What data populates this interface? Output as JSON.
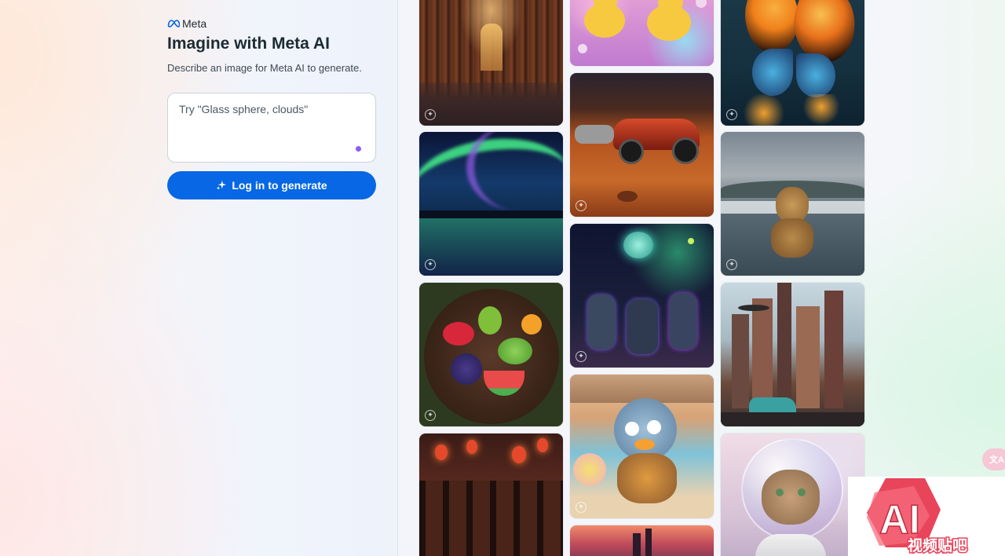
{
  "brand": {
    "name": "Meta",
    "logo_icon": "meta-infinity-icon",
    "logo_color": "#0668e1"
  },
  "header": {
    "title": "Imagine with Meta AI",
    "subtitle": "Describe an image for Meta AI to generate."
  },
  "prompt": {
    "placeholder": "Try \"Glass sphere, clouds\"",
    "value": ""
  },
  "login_button": {
    "label": "Log in to generate",
    "icon": "sparkle-icon",
    "color": "#0767e4"
  },
  "gallery": {
    "badge_icon": "meta-ai-icon",
    "columns": [
      [
        {
          "name": "library",
          "label": "Library with bookshelves"
        },
        {
          "name": "aurora",
          "label": "Aurora over water"
        },
        {
          "name": "fruit-platter",
          "label": "Fruit platter"
        },
        {
          "name": "lantern-hall",
          "label": "Hall with red lanterns"
        }
      ],
      [
        {
          "name": "rubber-ducks",
          "label": "Rubber ducks with bubbles"
        },
        {
          "name": "mars-rally-cars",
          "label": "Rally cars on Mars"
        },
        {
          "name": "space-cats",
          "label": "Astronaut cats"
        },
        {
          "name": "fluffy-bird",
          "label": "Fluffy cartoon bird"
        },
        {
          "name": "castle-sunset",
          "label": "Castle at sunset"
        }
      ],
      [
        {
          "name": "butterfly",
          "label": "Stained glass butterfly"
        },
        {
          "name": "dog-sea",
          "label": "Dog in the sea"
        },
        {
          "name": "retro-city",
          "label": "Retro futuristic city"
        },
        {
          "name": "kitten-astronaut",
          "label": "Kitten in space helmet"
        }
      ]
    ]
  },
  "translate_button": {
    "icon": "translate-icon"
  },
  "watermark": {
    "text": "AI 视频贴吧",
    "primary": "AI",
    "secondary": "视频贴吧"
  }
}
